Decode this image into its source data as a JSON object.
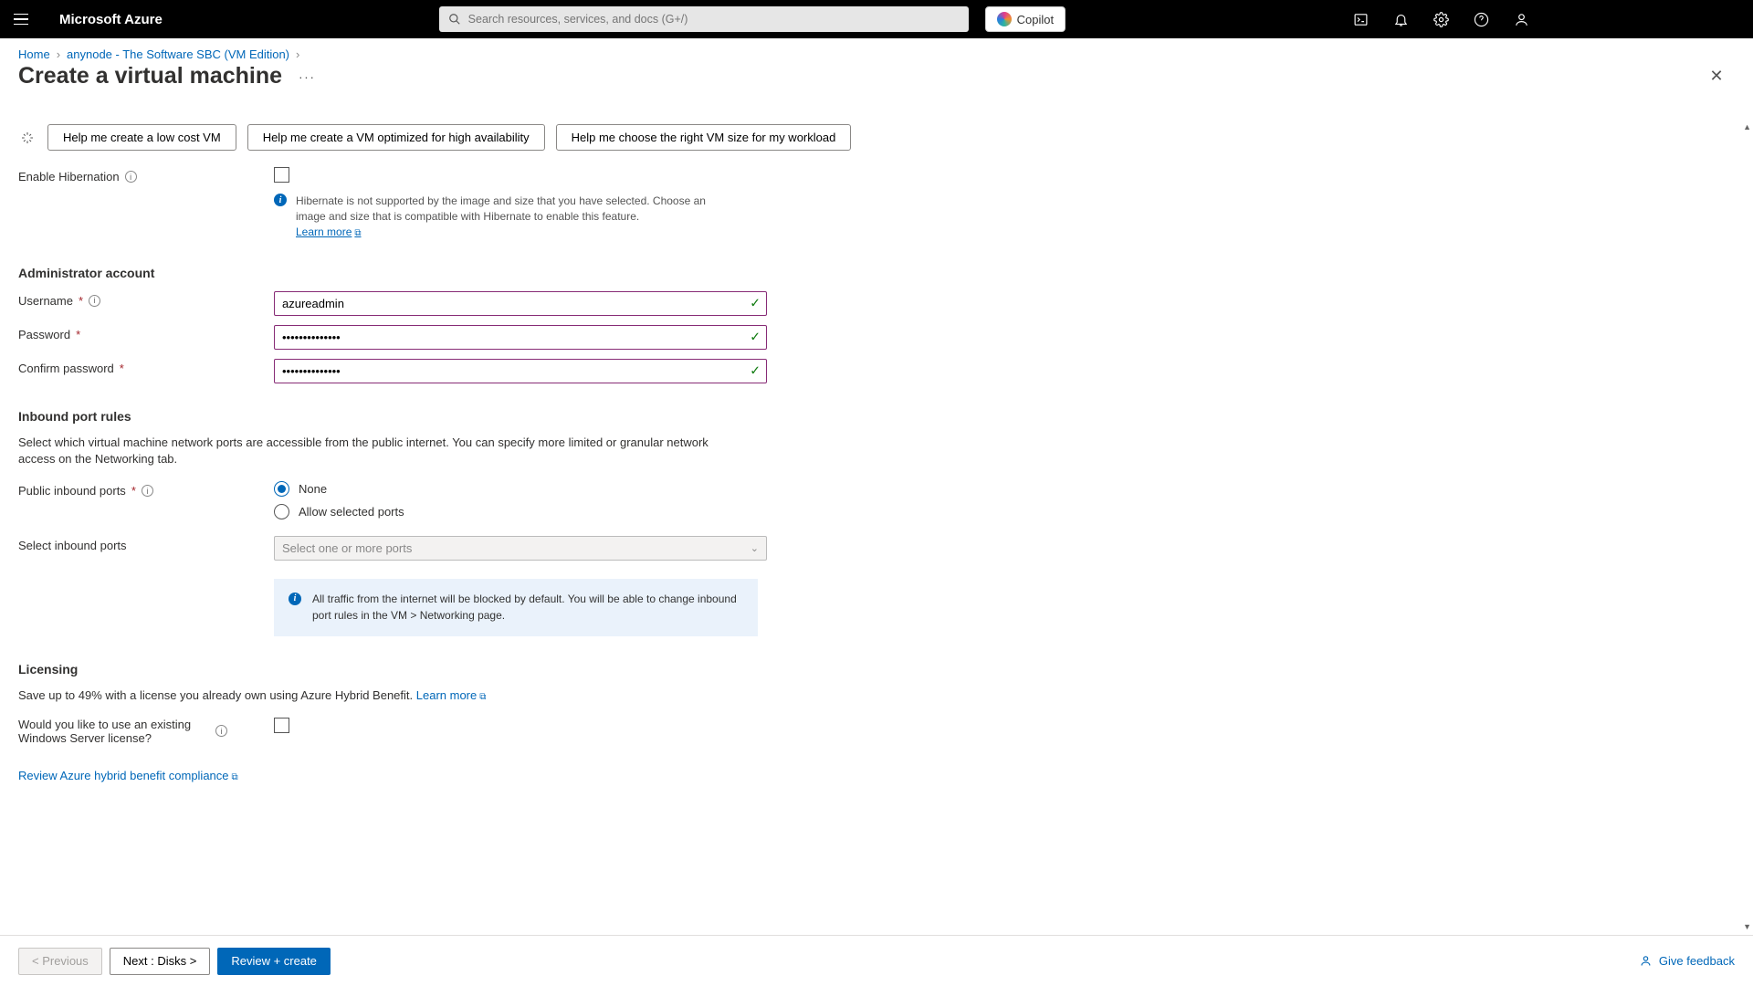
{
  "brand": "Microsoft Azure",
  "search_placeholder": "Search resources, services, and docs (G+/)",
  "copilot_label": "Copilot",
  "breadcrumb": {
    "home": "Home",
    "item1": "anynode - The Software SBC (VM Edition)"
  },
  "page_title": "Create a virtual machine",
  "pills": {
    "p1": "Help me create a low cost VM",
    "p2": "Help me create a VM optimized for high availability",
    "p3": "Help me choose the right VM size for my workload"
  },
  "hibernation": {
    "label": "Enable Hibernation",
    "info": "Hibernate is not supported by the image and size that you have selected. Choose an image and size that is compatible with Hibernate to enable this feature.",
    "learn_more": "Learn more"
  },
  "admin": {
    "heading": "Administrator account",
    "username_label": "Username",
    "username_value": "azureadmin",
    "password_label": "Password",
    "password_value": "••••••••••••••",
    "confirm_label": "Confirm password",
    "confirm_value": "••••••••••••••"
  },
  "ports": {
    "heading": "Inbound port rules",
    "desc": "Select which virtual machine network ports are accessible from the public internet. You can specify more limited or granular network access on the Networking tab.",
    "public_label": "Public inbound ports",
    "opt_none": "None",
    "opt_allow": "Allow selected ports",
    "select_label": "Select inbound ports",
    "select_placeholder": "Select one or more ports",
    "callout": "All traffic from the internet will be blocked by default. You will be able to change inbound port rules in the VM > Networking page."
  },
  "licensing": {
    "heading": "Licensing",
    "desc_prefix": "Save up to 49% with a license you already own using Azure Hybrid Benefit.  ",
    "learn_more": "Learn more",
    "existing_label": "Would you like to use an existing Windows Server license?",
    "compliance": "Review Azure hybrid benefit compliance"
  },
  "footer": {
    "prev": "< Previous",
    "next": "Next : Disks >",
    "review": "Review + create",
    "feedback": "Give feedback"
  }
}
